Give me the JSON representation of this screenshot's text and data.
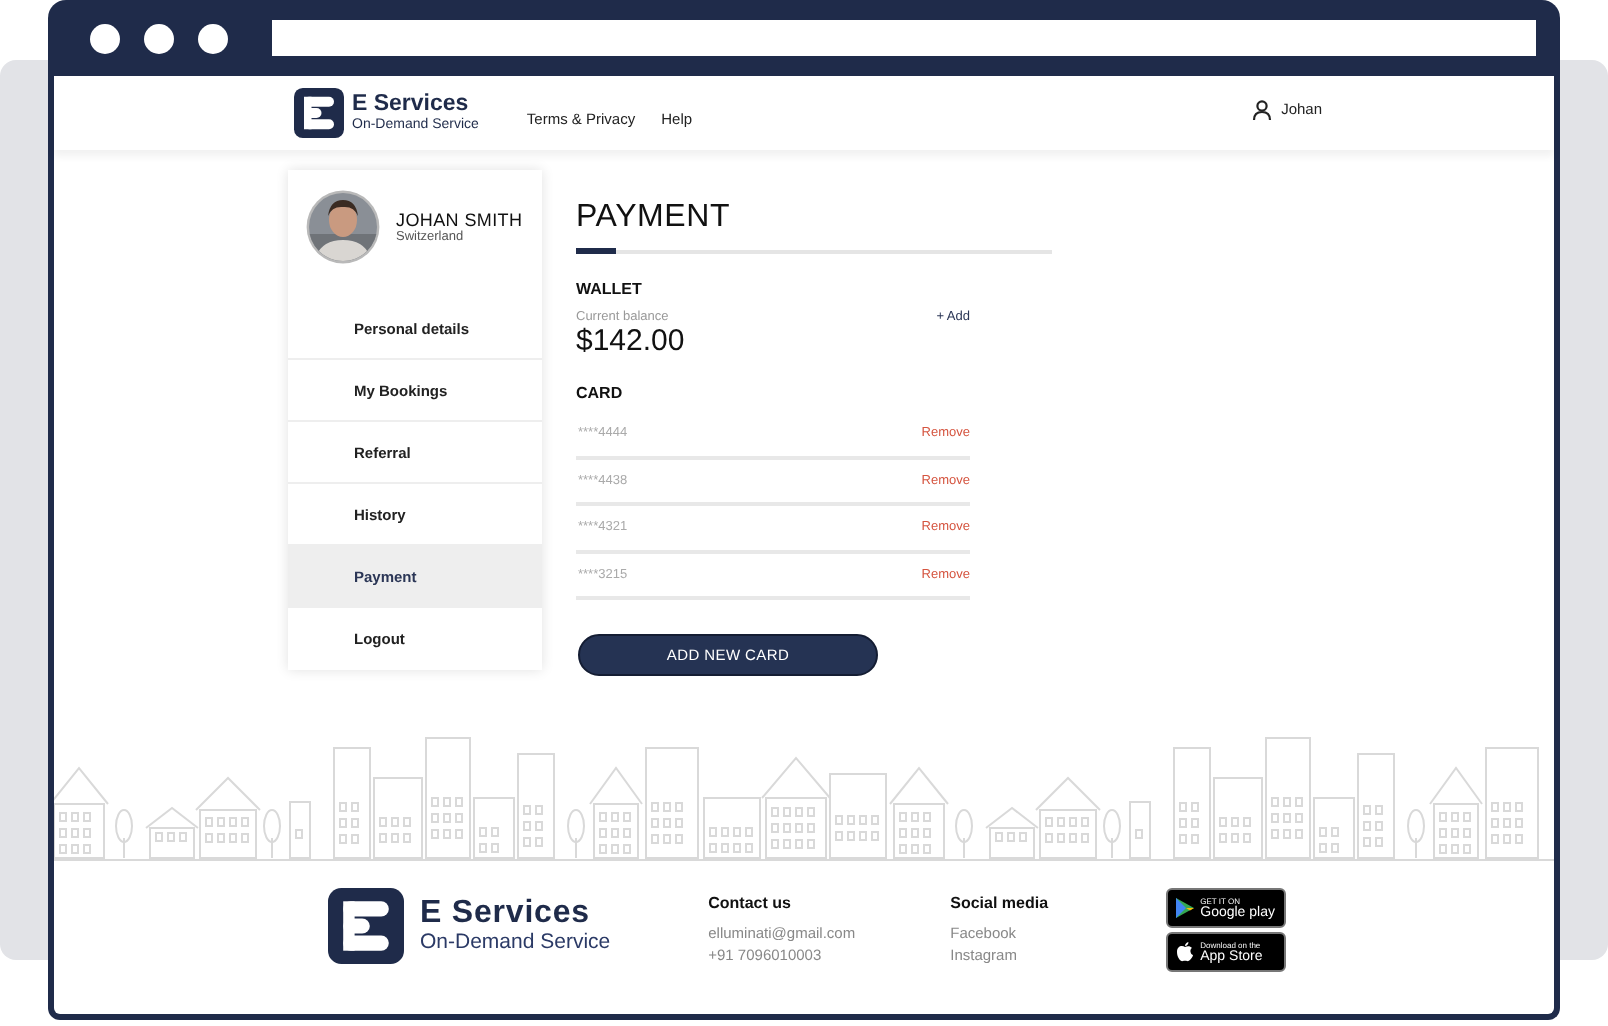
{
  "header": {
    "brand": {
      "name": "E Services",
      "tagline": "On-Demand Service"
    },
    "links": [
      "Terms & Privacy",
      "Help"
    ],
    "user": "Johan"
  },
  "profile": {
    "name": "JOHAN SMITH",
    "location": "Switzerland"
  },
  "menu": [
    {
      "label": "Personal details",
      "selected": false
    },
    {
      "label": "My Bookings",
      "selected": false
    },
    {
      "label": "Referral",
      "selected": false
    },
    {
      "label": "History",
      "selected": false
    },
    {
      "label": "Payment",
      "selected": true
    },
    {
      "label": "Logout",
      "selected": false
    }
  ],
  "payment": {
    "title": "PAYMENT",
    "wallet": {
      "heading": "WALLET",
      "balance_label": "Current balance",
      "add": "+ Add",
      "balance": "$142.00"
    },
    "card": {
      "heading": "CARD",
      "cards": [
        {
          "number": "****4444",
          "action": "Remove"
        },
        {
          "number": "****4438",
          "action": "Remove"
        },
        {
          "number": "****4321",
          "action": "Remove"
        },
        {
          "number": "****3215",
          "action": "Remove"
        }
      ]
    },
    "add_button": "ADD NEW CARD"
  },
  "footer": {
    "brand": {
      "name": "E Services",
      "tagline": "On-Demand Service"
    },
    "contact": {
      "heading": "Contact us",
      "lines": [
        "elluminati@gmail.com",
        "+91 7096010003"
      ]
    },
    "social": {
      "heading": "Social media",
      "links": [
        "Facebook",
        "Instagram"
      ]
    },
    "stores": [
      {
        "kind": "google",
        "small": "GET IT ON",
        "name": "Google play"
      },
      {
        "kind": "apple",
        "small": "Download on the",
        "name": "App Store"
      }
    ]
  }
}
